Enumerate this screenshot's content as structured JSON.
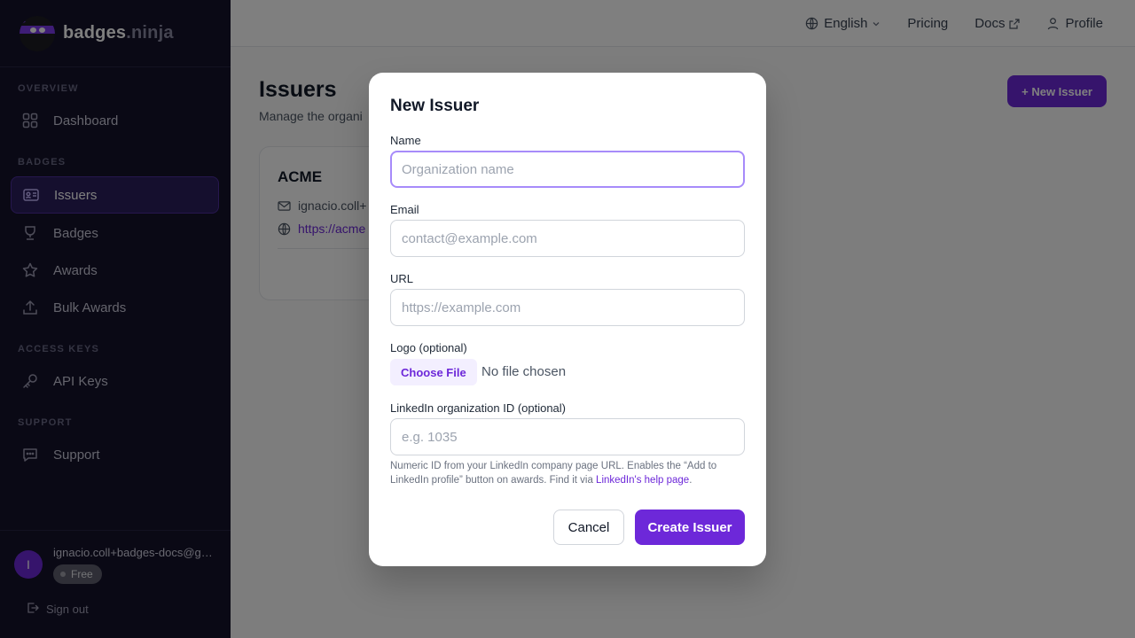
{
  "brand": {
    "name": "badges",
    "suffix": ".ninja"
  },
  "sidebar": {
    "sections": [
      {
        "label": "OVERVIEW"
      },
      {
        "label": "BADGES"
      },
      {
        "label": "ACCESS KEYS"
      },
      {
        "label": "SUPPORT"
      }
    ],
    "items": [
      {
        "label": "Dashboard",
        "icon": "grid-icon"
      },
      {
        "label": "Issuers",
        "icon": "id-card-icon",
        "active": true
      },
      {
        "label": "Badges",
        "icon": "trophy-icon"
      },
      {
        "label": "Awards",
        "icon": "star-icon"
      },
      {
        "label": "Bulk Awards",
        "icon": "upload-icon"
      },
      {
        "label": "API Keys",
        "icon": "key-icon"
      },
      {
        "label": "Support",
        "icon": "chat-icon"
      }
    ],
    "user": {
      "initial": "I",
      "email": "ignacio.coll+badges-docs@gmail.com",
      "plan": "Free",
      "sign_out": "Sign out"
    }
  },
  "header": {
    "language": "English",
    "pricing": "Pricing",
    "docs": "Docs",
    "profile": "Profile"
  },
  "main": {
    "title": "Issuers",
    "subtitle": "Manage the organi",
    "new_button": "+ New Issuer",
    "card": {
      "name": "ACME",
      "email": "ignacio.coll+",
      "url": "https://acme"
    }
  },
  "modal": {
    "title": "New Issuer",
    "name_label": "Name",
    "name_placeholder": "Organization name",
    "email_label": "Email",
    "email_placeholder": "contact@example.com",
    "url_label": "URL",
    "url_placeholder": "https://example.com",
    "logo_label": "Logo (optional)",
    "choose_file": "Choose File",
    "file_status": "No file chosen",
    "linkedin_label": "LinkedIn organization ID (optional)",
    "linkedin_placeholder": "e.g. 1035",
    "help_text": "Numeric ID from your LinkedIn company page URL. Enables the “Add to LinkedIn profile” button on awards. Find it via ",
    "help_link": "LinkedIn's help page",
    "help_end": ".",
    "cancel": "Cancel",
    "create": "Create Issuer"
  },
  "colors": {
    "accent": "#6d28d9",
    "sidebar_bg": "#14122b"
  }
}
